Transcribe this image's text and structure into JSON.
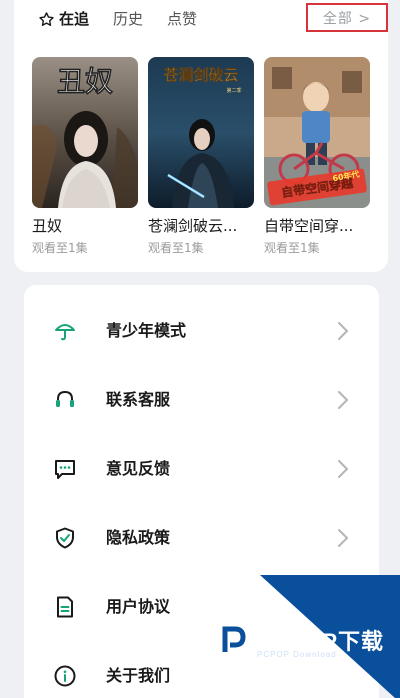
{
  "tabs": [
    {
      "label": "在追",
      "icon": "star-icon",
      "active": true
    },
    {
      "label": "历史",
      "active": false
    },
    {
      "label": "点赞",
      "active": false
    }
  ],
  "all_button": {
    "label": "全部 >"
  },
  "dramas": [
    {
      "title": "丑奴",
      "progress": "观看至1集",
      "poster_text": "丑奴"
    },
    {
      "title": "苍澜剑破云...",
      "progress": "观看至1集",
      "poster_text": "苍澜剑破云",
      "poster_subtext": "第二季"
    },
    {
      "title": "自带空间穿...",
      "progress": "观看至1集",
      "poster_text": "自带空间穿越",
      "poster_subtext": "60年代"
    }
  ],
  "menu": [
    {
      "label": "青少年模式",
      "icon": "umbrella-icon"
    },
    {
      "label": "联系客服",
      "icon": "headset-icon"
    },
    {
      "label": "意见反馈",
      "icon": "feedback-chat-icon"
    },
    {
      "label": "隐私政策",
      "icon": "shield-check-icon"
    },
    {
      "label": "用户协议",
      "icon": "document-icon"
    },
    {
      "label": "关于我们",
      "icon": "info-icon"
    }
  ],
  "colors": {
    "accent": "#17a37a",
    "highlight_box": "#d6343a",
    "watermark": "#0a4f9c"
  },
  "watermark": {
    "brand": "PCPOP下载",
    "small": "PCPOP Download"
  }
}
